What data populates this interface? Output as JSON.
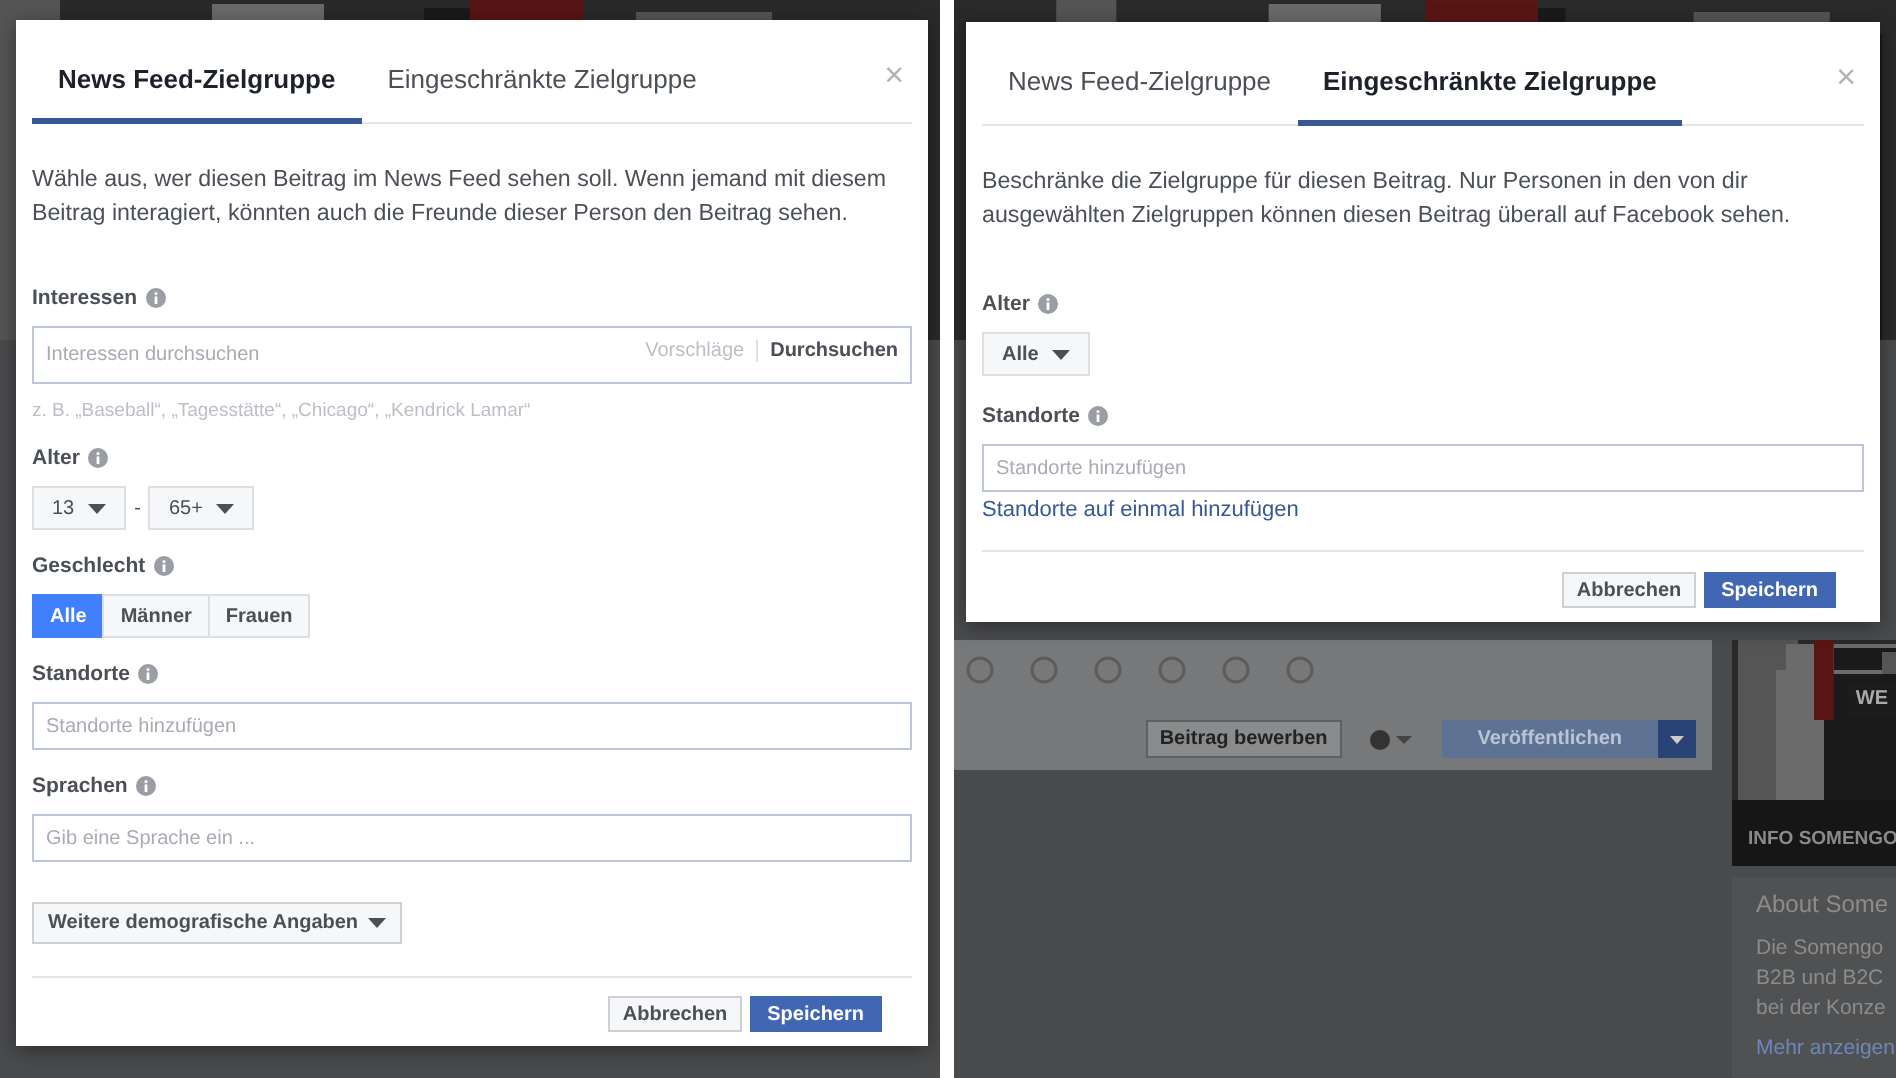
{
  "panels": [
    {
      "dialog": {
        "tabs": [
          {
            "label": "News Feed-Zielgruppe",
            "selected": true
          },
          {
            "label": "Eingeschränkte Zielgruppe",
            "selected": false
          }
        ],
        "close": "×",
        "description": "Wähle aus, wer diesen Beitrag im News Feed sehen soll. Wenn jemand mit diesem Beitrag interagiert, könnten auch die Freunde dieser Person den Beitrag sehen.",
        "fields": [
          {
            "kind": "search",
            "label": "Interessen",
            "placeholder": "Interessen durchsuchen",
            "suggest": "Vorschläge",
            "action": "Durchsuchen",
            "hint": "z. B. „Baseball“, „Tagesstätte“, „Chicago“, „Kendrick Lamar“"
          },
          {
            "kind": "range",
            "label": "Alter",
            "from": "13",
            "separator": "-",
            "to": "65+"
          },
          {
            "kind": "segmented",
            "label": "Geschlecht",
            "options": [
              {
                "label": "Alle",
                "selected": true
              },
              {
                "label": "Männer",
                "selected": false
              },
              {
                "label": "Frauen",
                "selected": false
              }
            ]
          },
          {
            "kind": "text",
            "label": "Standorte",
            "placeholder": "Standorte hinzufügen"
          },
          {
            "kind": "text",
            "label": "Sprachen",
            "placeholder": "Gib eine Sprache ein ..."
          },
          {
            "kind": "menu",
            "value": "Weitere demografische Angaben"
          }
        ],
        "buttons": [
          {
            "label": "Abbrechen",
            "primary": false
          },
          {
            "label": "Speichern",
            "primary": true
          }
        ]
      }
    },
    {
      "dialog": {
        "tabs": [
          {
            "label": "News Feed-Zielgruppe",
            "selected": false
          },
          {
            "label": "Eingeschränkte Zielgruppe",
            "selected": true
          }
        ],
        "close": "×",
        "description": "Beschränke die Zielgruppe für diesen Beitrag. Nur Personen in den von dir ausgewählten Zielgruppen können diesen Beitrag überall auf Facebook sehen.",
        "fields": [
          {
            "kind": "select",
            "label": "Alter",
            "value": "Alle"
          },
          {
            "kind": "text",
            "label": "Standorte",
            "placeholder": "Standorte hinzufügen",
            "link": "Standorte auf einmal hinzufügen"
          }
        ],
        "buttons": [
          {
            "label": "Abbrechen",
            "primary": false
          },
          {
            "label": "Speichern",
            "primary": true
          }
        ]
      },
      "background": {
        "promote_button": "Beitrag bewerben",
        "publish_button": "Veröffentlichen",
        "photo_label": "WE",
        "photo_caption": "INFO SOMENGO",
        "about_title": "About Some",
        "about_lines": [
          "Die Somengo",
          "B2B und B2C",
          "bei der Konze"
        ],
        "about_link": "Mehr anzeigen"
      }
    }
  ]
}
